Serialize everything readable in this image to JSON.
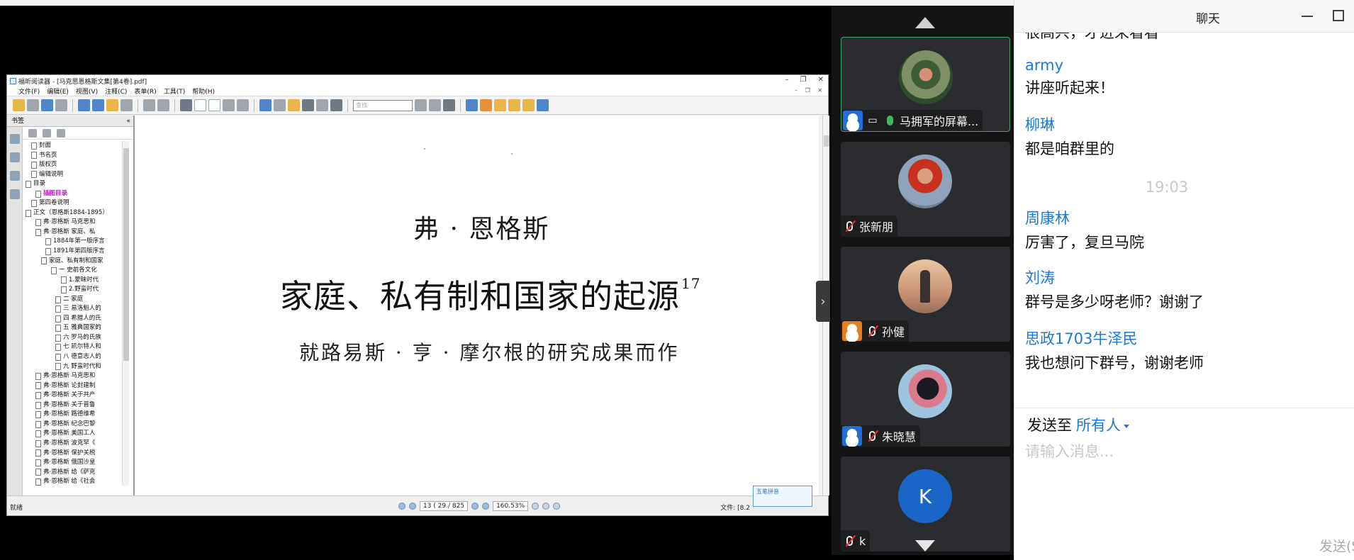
{
  "pdf_reader": {
    "title": "福昕阅读器 - [马克思恩格斯文集[第4卷].pdf]",
    "menu": [
      "文件(F)",
      "编辑(E)",
      "视图(V)",
      "注释(C)",
      "表单(R)",
      "工具(T)",
      "帮助(H)"
    ],
    "search_placeholder": "查找",
    "bookmarks_label": "书签",
    "tree": [
      "封面",
      "书名页",
      "版权页",
      "编辑说明",
      "目录",
      "插图目录",
      "第四卷说明",
      "正文（恩格斯1884-1895）",
      "弗·恩格斯 马克思和",
      "弗·恩格斯 家庭、私",
      "1884年第一版序言",
      "1891年第四版序言",
      "家庭、私有制和国家",
      "一 史前各文化",
      "1.蒙昧时代",
      "2.野蛮时代",
      "二 家庭",
      "三 易洛魁人的",
      "四 希腊人的氏",
      "五 雅典国家的",
      "六 罗马的氏族",
      "七 凯尔特人和",
      "八 德意志人的",
      "九 野蛮时代和",
      "弗·恩格斯 马克思和",
      "弗·恩格斯 论封建制",
      "弗·恩格斯 关于共产",
      "弗·恩格斯 关于普鲁",
      "弗·恩格斯 路德维希",
      "弗·恩格斯 纪念巴黎",
      "弗·恩格斯 美国工人",
      "弗·恩格斯 波克罕《",
      "弗·恩格斯 保护关税",
      "弗·恩格斯 俄国沙皇",
      "弗·恩格斯 给《萨克",
      "弗·恩格斯 给《社会"
    ],
    "page": {
      "author": "弗 · 恩格斯",
      "title": "家庭、私有制和国家的起源",
      "title_note": "17",
      "subtitle": "就路易斯 · 亨 · 摩尔根的研究成果而作"
    },
    "status": {
      "ready": "就绪",
      "page_field": "13 ( 29 / 825",
      "zoom": "160.53%",
      "file_info": "文件: [8.2",
      "ime": "五笔拼音"
    }
  },
  "participants": [
    {
      "name": "马拥军的屏幕...",
      "host": true,
      "screen": true,
      "mic": "on",
      "active": true
    },
    {
      "name": "张新朋",
      "host": false,
      "screen": false,
      "mic": "off",
      "active": false
    },
    {
      "name": "孙健",
      "host": true,
      "screen": false,
      "mic": "off",
      "active": false
    },
    {
      "name": "朱晓慧",
      "host": true,
      "screen": false,
      "mic": "off",
      "active": false
    },
    {
      "name": "k",
      "host": false,
      "screen": false,
      "mic": "off",
      "active": false,
      "initial": "K"
    }
  ],
  "chat": {
    "title": "聊天",
    "cut_text": "很高兴，才进来看看",
    "messages": [
      {
        "name": "army",
        "text": "讲座听起来！"
      },
      {
        "name": "柳琳",
        "text": "都是咱群里的"
      },
      {
        "time": "19:03"
      },
      {
        "name": "周康林",
        "text": "厉害了，复旦马院"
      },
      {
        "name": "刘涛",
        "text": "群号是多少呀老师？谢谢了"
      },
      {
        "name": "思政1703牛泽民",
        "text": "我也想问下群号，谢谢老师"
      }
    ],
    "send_to_label": "发送至",
    "send_to_value": "所有人",
    "input_placeholder": "请输入消息...",
    "send_button": "发送(S)"
  },
  "colors": {
    "accent": "#1a78d6",
    "active_border": "#3ea86a",
    "host_badge": "#1f6fd6"
  }
}
